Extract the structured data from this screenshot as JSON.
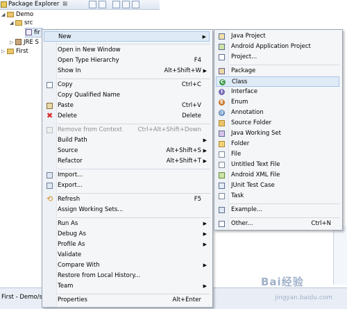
{
  "explorer": {
    "title": "Package Explorer",
    "close": "⊠",
    "tree": [
      {
        "label": "Demo"
      },
      {
        "label": "src"
      },
      {
        "label": "fir"
      },
      {
        "label": "JRE S"
      },
      {
        "label": "First"
      }
    ]
  },
  "status": {
    "text": "First - Demo/src"
  },
  "watermark": {
    "logo": "Bai经验",
    "sub": "jingyan.baidu.com"
  },
  "context_menu": {
    "items": [
      {
        "label": "New",
        "accel": "",
        "submenu": true
      },
      {
        "label": "Open in New Window",
        "accel": ""
      },
      {
        "label": "Open Type Hierarchy",
        "accel": "F4"
      },
      {
        "label": "Show In",
        "accel": "Alt+Shift+W",
        "submenu": true
      },
      {
        "label": "Copy",
        "accel": "Ctrl+C"
      },
      {
        "label": "Copy Qualified Name",
        "accel": ""
      },
      {
        "label": "Paste",
        "accel": "Ctrl+V"
      },
      {
        "label": "Delete",
        "accel": "Delete"
      },
      {
        "label": "Remove from Context",
        "accel": "Ctrl+Alt+Shift+Down",
        "disabled": true
      },
      {
        "label": "Build Path",
        "accel": "",
        "submenu": true
      },
      {
        "label": "Source",
        "accel": "Alt+Shift+S",
        "submenu": true
      },
      {
        "label": "Refactor",
        "accel": "Alt+Shift+T",
        "submenu": true
      },
      {
        "label": "Import...",
        "accel": ""
      },
      {
        "label": "Export...",
        "accel": ""
      },
      {
        "label": "Refresh",
        "accel": "F5"
      },
      {
        "label": "Assign Working Sets...",
        "accel": ""
      },
      {
        "label": "Run As",
        "accel": "",
        "submenu": true
      },
      {
        "label": "Debug As",
        "accel": "",
        "submenu": true
      },
      {
        "label": "Profile As",
        "accel": "",
        "submenu": true
      },
      {
        "label": "Validate",
        "accel": ""
      },
      {
        "label": "Compare With",
        "accel": "",
        "submenu": true
      },
      {
        "label": "Restore from Local History...",
        "accel": ""
      },
      {
        "label": "Team",
        "accel": "",
        "submenu": true
      },
      {
        "label": "Properties",
        "accel": "Alt+Enter"
      }
    ]
  },
  "new_submenu": {
    "items": [
      {
        "label": "Java Project",
        "accel": ""
      },
      {
        "label": "Android Application Project",
        "accel": ""
      },
      {
        "label": "Project...",
        "accel": ""
      },
      {
        "label": "Package",
        "accel": ""
      },
      {
        "label": "Class",
        "accel": ""
      },
      {
        "label": "Interface",
        "accel": ""
      },
      {
        "label": "Enum",
        "accel": ""
      },
      {
        "label": "Annotation",
        "accel": ""
      },
      {
        "label": "Source Folder",
        "accel": ""
      },
      {
        "label": "Java Working Set",
        "accel": ""
      },
      {
        "label": "Folder",
        "accel": ""
      },
      {
        "label": "File",
        "accel": ""
      },
      {
        "label": "Untitled Text File",
        "accel": ""
      },
      {
        "label": "Android XML File",
        "accel": ""
      },
      {
        "label": "JUnit Test Case",
        "accel": ""
      },
      {
        "label": "Task",
        "accel": ""
      },
      {
        "label": "Example...",
        "accel": ""
      },
      {
        "label": "Other...",
        "accel": "Ctrl+N"
      }
    ]
  },
  "icons": {
    "copy": "copy-icon",
    "paste": "paste-icon",
    "delete": "delete-icon",
    "import": "import-icon",
    "export": "export-icon",
    "refresh": "refresh-icon",
    "class": "class-icon",
    "interface": "interface-icon",
    "enum": "enum-icon"
  }
}
